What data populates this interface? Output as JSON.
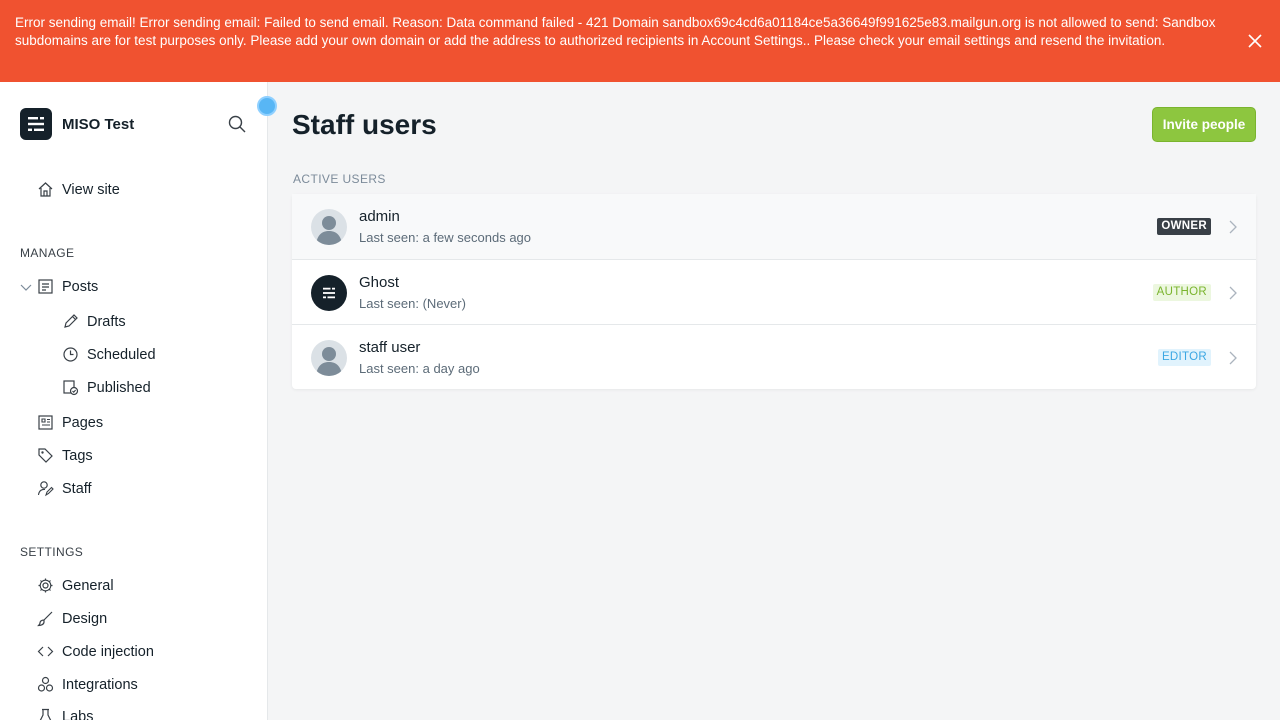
{
  "alert": {
    "message": "Error sending email! Error sending email: Failed to send email. Reason: Data command failed - 421 Domain sandbox69c4cd6a01184ce5a36649f991625e83.mailgun.org is not allowed to send: Sandbox subdomains are for test purposes only. Please add your own domain or add the address to authorized recipients in Account Settings.. Please check your email settings and resend the invitation.",
    "color": "#f05230"
  },
  "sidebar": {
    "site_name": "MISO Test",
    "view_site": "View site",
    "manage_label": "MANAGE",
    "posts": "Posts",
    "drafts": "Drafts",
    "scheduled": "Scheduled",
    "published": "Published",
    "pages": "Pages",
    "tags": "Tags",
    "staff": "Staff",
    "settings_label": "SETTINGS",
    "general": "General",
    "design": "Design",
    "code_injection": "Code injection",
    "integrations": "Integrations",
    "labs": "Labs"
  },
  "main": {
    "title": "Staff users",
    "invite_button": "Invite people",
    "active_label": "ACTIVE USERS",
    "users": [
      {
        "name": "admin",
        "last_seen": "Last seen: a few seconds ago",
        "role": "OWNER"
      },
      {
        "name": "Ghost",
        "last_seen": "Last seen: (Never)",
        "role": "AUTHOR"
      },
      {
        "name": "staff user",
        "last_seen": "Last seen: a day ago",
        "role": "EDITOR"
      }
    ]
  },
  "colors": {
    "accent_green": "#8dc63f",
    "dark": "#15212a"
  }
}
